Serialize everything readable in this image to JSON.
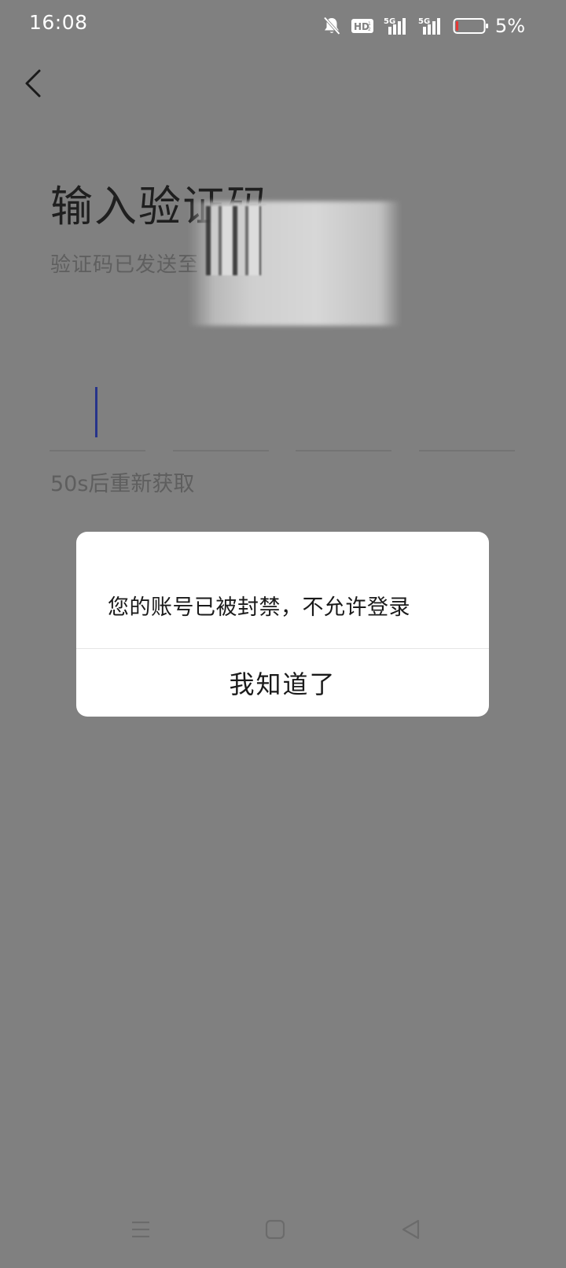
{
  "status_bar": {
    "time": "16:08",
    "icons": [
      "mute-bell-icon",
      "hd-voice-icon",
      "5g-signal-icon",
      "5g-signal-icon",
      "battery-icon"
    ],
    "battery_percent": "5%",
    "battery_level": 0.05,
    "battery_color": "#e53935"
  },
  "header": {
    "back_icon": "chevron-left-icon"
  },
  "main": {
    "title": "输入验证码",
    "subtitle": "验证码已发送至",
    "code_length": 4,
    "resend_text": "50s后重新获取",
    "caret_color": "#27348a"
  },
  "dialog": {
    "message": "您的账号已被封禁，不允许登录",
    "confirm_label": "我知道了"
  },
  "nav_bar": {
    "icons": [
      "menu-icon",
      "home-icon",
      "back-icon"
    ]
  }
}
